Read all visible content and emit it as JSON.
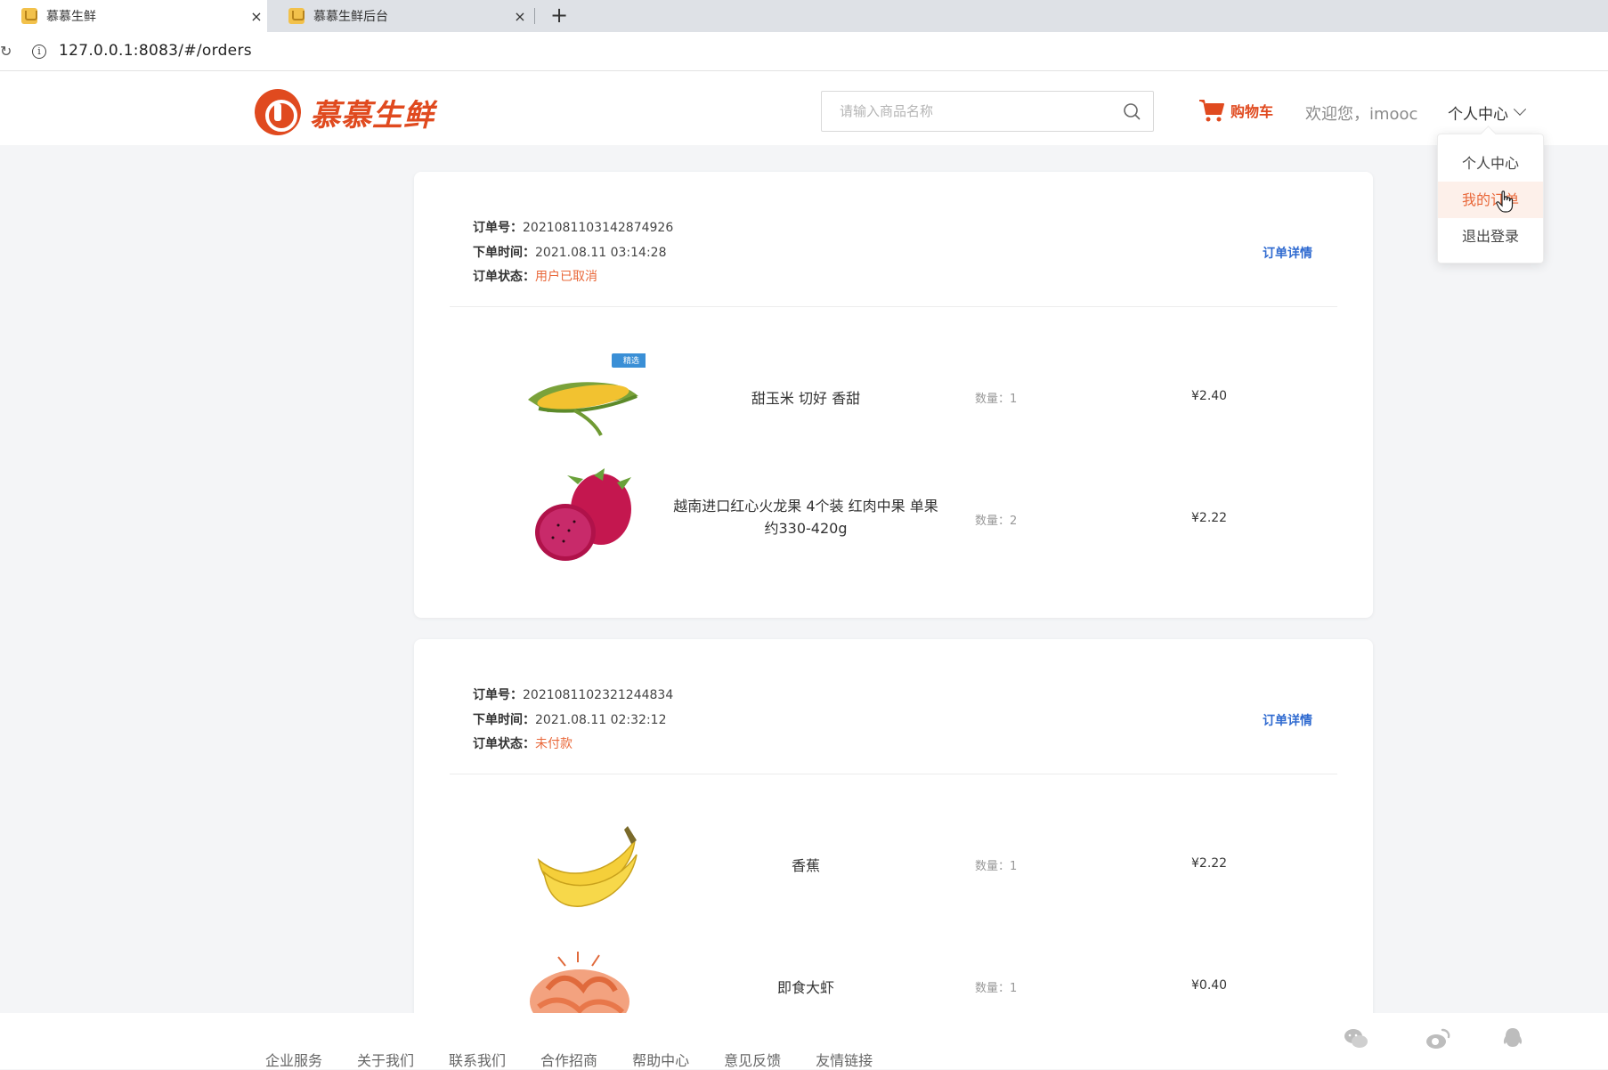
{
  "browser": {
    "tabs": [
      {
        "title": "慕慕生鲜",
        "active": true
      },
      {
        "title": "慕慕生鲜后台",
        "active": false
      }
    ],
    "close_glyph": "×",
    "new_tab_glyph": "+",
    "url": "127.0.0.1:8083/#/orders"
  },
  "header": {
    "logo_text": "慕慕生鲜",
    "search_placeholder": "请输入商品名称",
    "cart_label": "购物车",
    "welcome": "欢迎您，imooc",
    "user_menu_label": "个人中心"
  },
  "dropdown": {
    "items": [
      "个人中心",
      "我的订单",
      "退出登录"
    ],
    "active_index": 1
  },
  "labels": {
    "order_no": "订单号：",
    "order_time": "下单时间：",
    "order_status": "订单状态：",
    "order_detail": "订单详情",
    "qty_prefix": "数量："
  },
  "orders": [
    {
      "order_no": "2021081103142874926",
      "order_time": "2021.08.11 03:14:28",
      "status": "用户已取消",
      "items": [
        {
          "name": "甜玉米 切好 香甜",
          "qty": "1",
          "price": "¥2.40",
          "image": "corn",
          "badge": "精选"
        },
        {
          "name": "越南进口红心火龙果 4个装 红肉中果 单果约330-420g",
          "qty": "2",
          "price": "¥2.22",
          "image": "dragon-fruit"
        }
      ]
    },
    {
      "order_no": "2021081102321244834",
      "order_time": "2021.08.11 02:32:12",
      "status": "未付款",
      "items": [
        {
          "name": "香蕉",
          "qty": "1",
          "price": "¥2.22",
          "image": "banana"
        },
        {
          "name": "即食大虾",
          "qty": "1",
          "price": "¥0.40",
          "image": "shrimp"
        }
      ]
    }
  ],
  "footer": {
    "links": [
      "企业服务",
      "关于我们",
      "联系我们",
      "合作招商",
      "帮助中心",
      "意见反馈",
      "友情链接"
    ],
    "social_icons": [
      "wechat-icon",
      "weibo-icon",
      "qq-icon"
    ]
  },
  "colors": {
    "brand": "#e04a1f",
    "status": "#e9683a",
    "link": "#2f6ad0"
  }
}
